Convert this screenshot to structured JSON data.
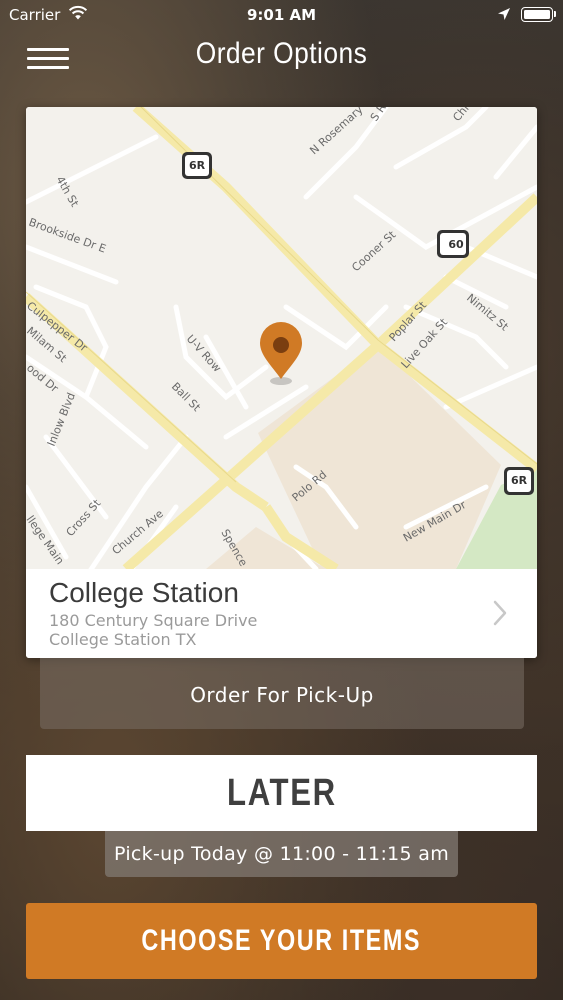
{
  "status_bar": {
    "carrier": "Carrier",
    "time": "9:01 AM",
    "icons": [
      "wifi-icon",
      "location-arrow-icon",
      "battery-icon"
    ]
  },
  "nav": {
    "title": "Order Options",
    "menu_icon": "hamburger-menu-icon"
  },
  "map": {
    "street_labels": [
      "4th St",
      "Brookside Dr E",
      "Culpepper Dr",
      "Milam St",
      "Inlow Blvd",
      "U-V Row",
      "Ball St",
      "Cooner St",
      "Poplar St",
      "Live Oak St",
      "Nimitz St",
      "N Rosemary",
      "Polo Rd",
      "New Main Dr",
      "Cross St",
      "Church Ave",
      "Spence",
      "ood Dr",
      "llege Main",
      "S R",
      "Chi"
    ],
    "shields": [
      "6R",
      "60",
      "6R"
    ],
    "marker_color": "#d07a25",
    "marker_icon": "map-pin-icon"
  },
  "location": {
    "name": "College Station",
    "address_line1": "180 Century Square Drive",
    "address_line2": "College Station TX",
    "chevron_icon": "chevron-right-icon"
  },
  "order_type": {
    "label": "Order For Pick-Up"
  },
  "timing": {
    "label": "LATER",
    "pickup_window": "Pick-up Today @ 11:00 - 11:15 am"
  },
  "cta": {
    "label": "CHOOSE YOUR ITEMS"
  },
  "colors": {
    "accent": "#d07a25",
    "map_background": "#f3f1ec",
    "major_road": "#f5e9a8",
    "park": "#d4e8c4"
  }
}
